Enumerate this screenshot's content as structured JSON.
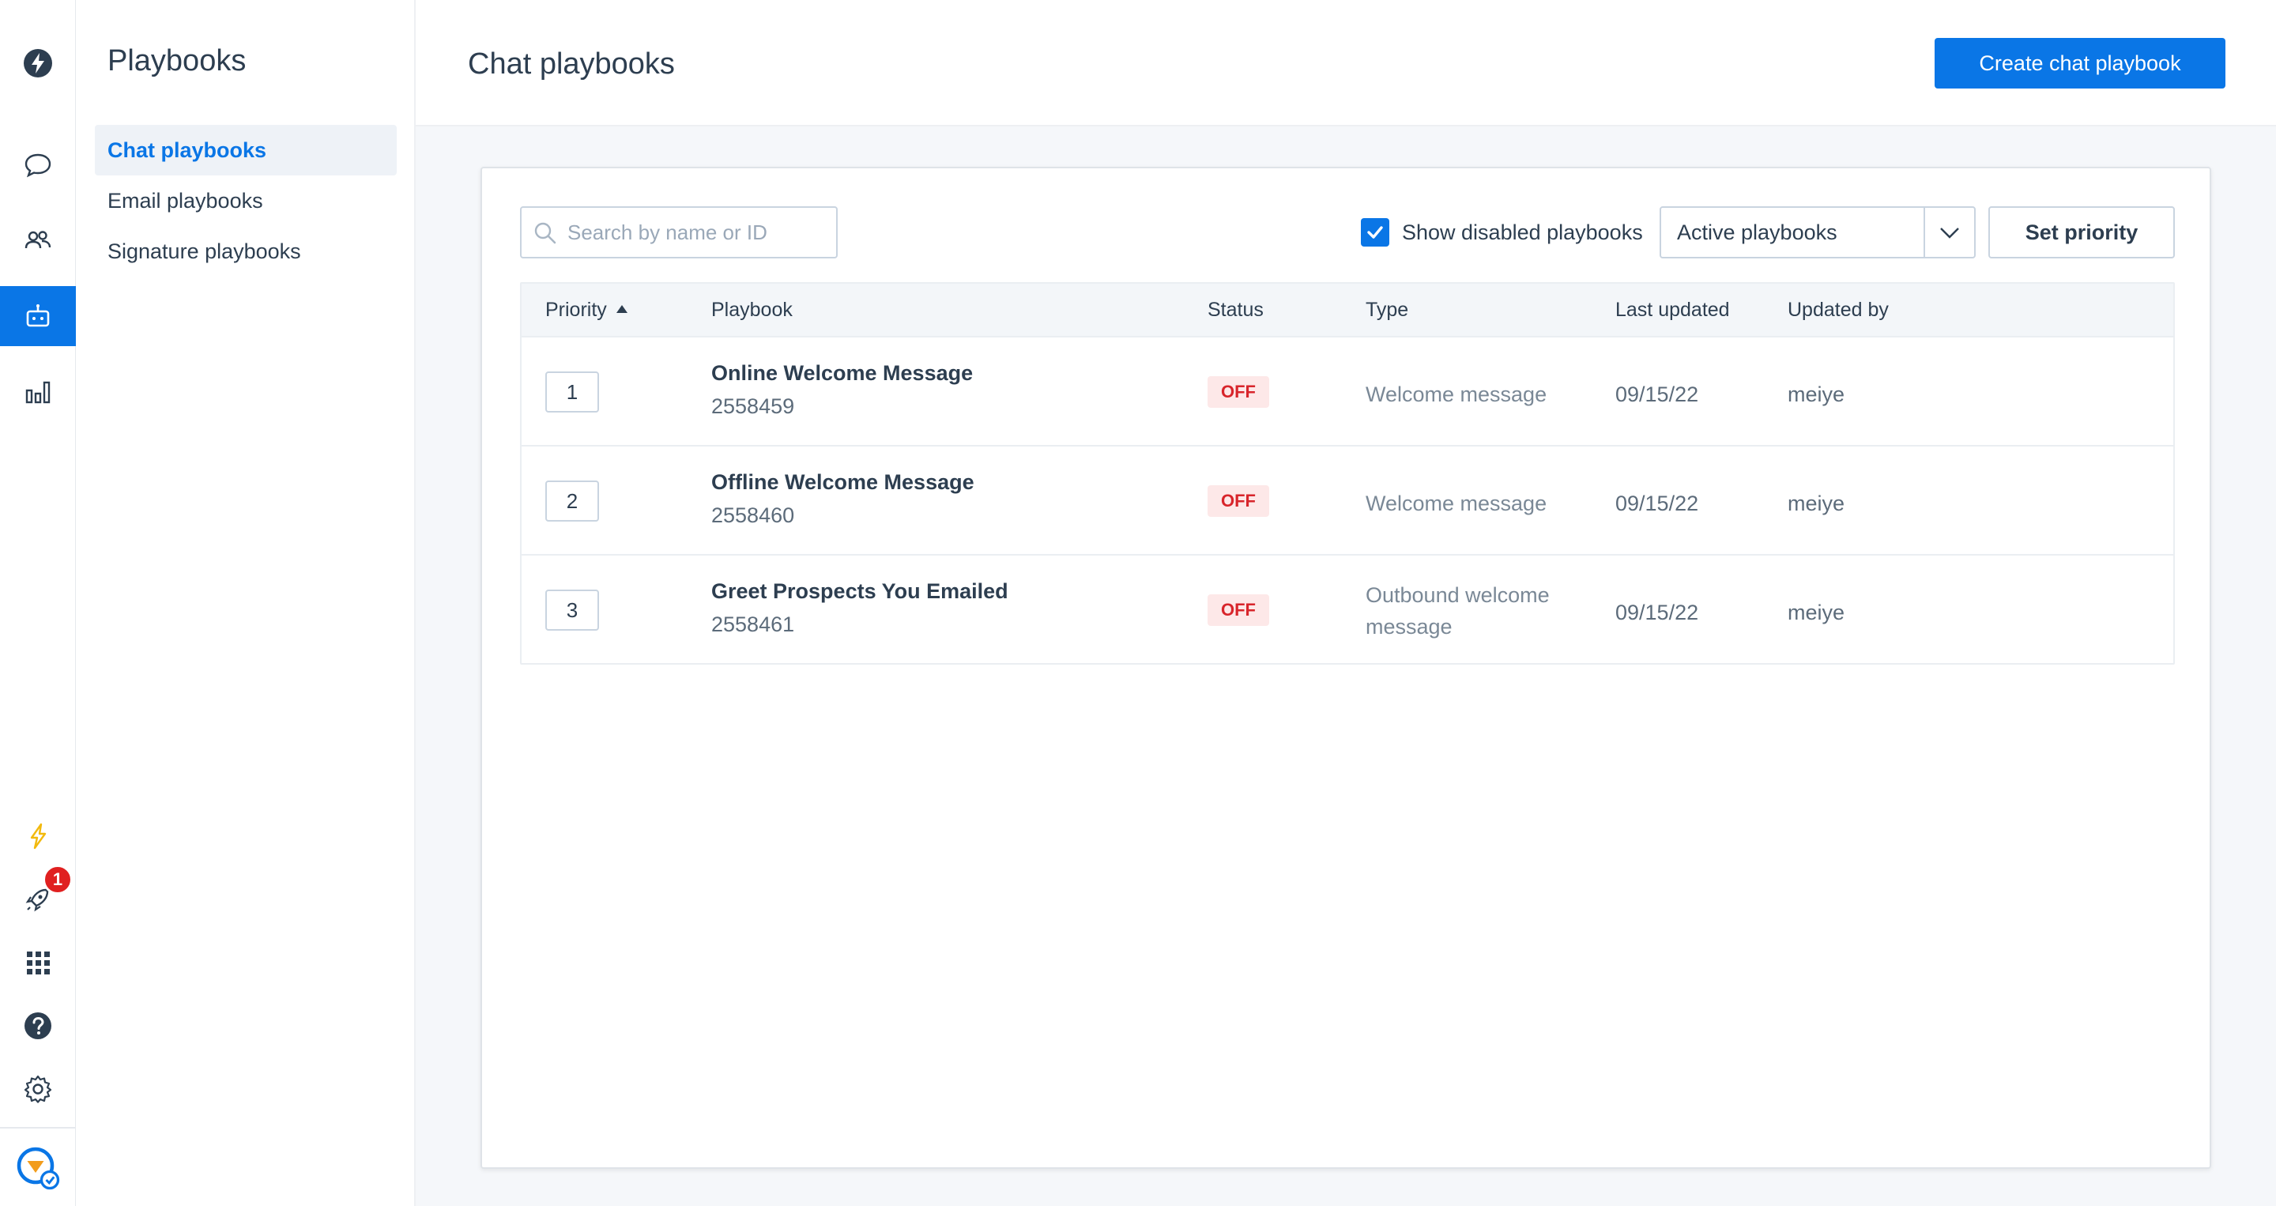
{
  "rail": {
    "items": [
      {
        "icon": "logo-bolt-icon"
      },
      {
        "icon": "chat-bubble-icon"
      },
      {
        "icon": "people-icon"
      },
      {
        "icon": "bot-icon",
        "active": true
      },
      {
        "icon": "bar-chart-icon"
      }
    ],
    "bottom": [
      {
        "icon": "lightning-icon"
      },
      {
        "icon": "rocket-icon"
      },
      {
        "icon": "apps-grid-icon"
      },
      {
        "icon": "help-icon"
      },
      {
        "icon": "settings-gear-icon"
      },
      {
        "icon": "account-avatar-icon"
      }
    ],
    "notification_count": "1",
    "accent": "#0a76e6"
  },
  "subnav": {
    "title": "Playbooks",
    "items": [
      {
        "label": "Chat playbooks",
        "active": true
      },
      {
        "label": "Email playbooks"
      },
      {
        "label": "Signature playbooks"
      }
    ]
  },
  "header": {
    "title": "Chat playbooks",
    "create_button": "Create chat playbook"
  },
  "toolbar": {
    "search_placeholder": "Search by name or ID",
    "search_value": "",
    "show_disabled_label": "Show disabled playbooks",
    "show_disabled_checked": true,
    "filter_value": "Active playbooks",
    "set_priority_label": "Set priority"
  },
  "table": {
    "columns": [
      "Priority",
      "Playbook",
      "Status",
      "Type",
      "Last updated",
      "Updated by"
    ],
    "rows": [
      {
        "priority": "1",
        "name": "Online Welcome Message",
        "id": "2558459",
        "status": "OFF",
        "type": "Welcome message",
        "last_updated": "09/15/22",
        "updated_by": "meiye"
      },
      {
        "priority": "2",
        "name": "Offline Welcome Message",
        "id": "2558460",
        "status": "OFF",
        "type": "Welcome message",
        "last_updated": "09/15/22",
        "updated_by": "meiye"
      },
      {
        "priority": "3",
        "name": "Greet Prospects You Emailed",
        "id": "2558461",
        "status": "OFF",
        "type": "Outbound welcome message",
        "last_updated": "09/15/22",
        "updated_by": "meiye"
      }
    ]
  },
  "colors": {
    "primary": "#0a76e6",
    "status_off_text": "#d8252b",
    "status_off_bg": "#fde8e8"
  }
}
